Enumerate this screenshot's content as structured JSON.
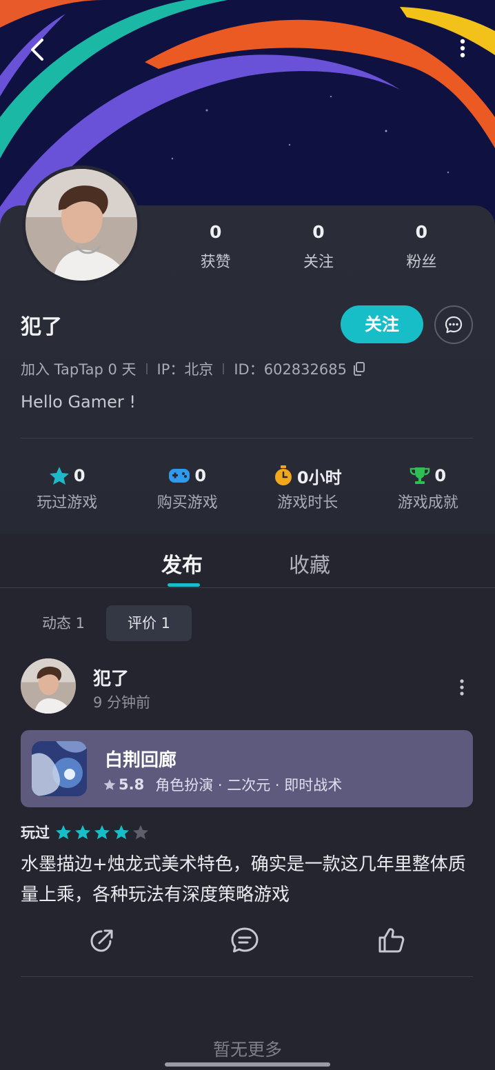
{
  "header": {
    "back_icon": "chevron-left-icon",
    "more_icon": "more-vertical-icon"
  },
  "profile": {
    "stats": [
      {
        "value": "0",
        "label": "获赞"
      },
      {
        "value": "0",
        "label": "关注"
      },
      {
        "value": "0",
        "label": "粉丝"
      }
    ],
    "username": "犯了",
    "follow_label": "关注",
    "meta": {
      "joined": "加入 TapTap 0 天",
      "ip": "IP：北京",
      "id": "ID：602832685"
    },
    "bio": "Hello Gamer !"
  },
  "game_stats": [
    {
      "icon": "star-icon",
      "color": "#1fb8c8",
      "value": "0",
      "label": "玩过游戏"
    },
    {
      "icon": "gamepad-icon",
      "color": "#2e9bef",
      "value": "0",
      "label": "购买游戏"
    },
    {
      "icon": "stopwatch-icon",
      "color": "#f2a81d",
      "value": "0小时",
      "label": "游戏时长"
    },
    {
      "icon": "trophy-icon",
      "color": "#2fbf55",
      "value": "0",
      "label": "游戏成就"
    }
  ],
  "tabs": {
    "publish": "发布",
    "favorites": "收藏"
  },
  "subtabs": {
    "dynamic": "动态 1",
    "review": "评价 1"
  },
  "post": {
    "author": "犯了",
    "time": "9 分钟前",
    "game": {
      "title": "白荆回廊",
      "score": "5.8",
      "tags": "角色扮演 · 二次元 · 即时战术"
    },
    "played_label": "玩过",
    "rating": 4,
    "rating_max": 5,
    "text": "水墨描边+烛龙式美术特色，确实是一款这几年里整体质量上乘，各种玩法有深度策略游戏"
  },
  "footer": {
    "no_more": "暂无更多"
  },
  "colors": {
    "accent": "#17bec8",
    "background": "#24252f",
    "game_card": "#5d5a7e"
  }
}
